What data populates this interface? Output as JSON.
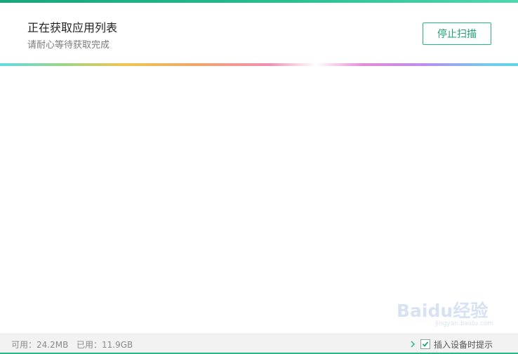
{
  "header": {
    "title": "正在获取应用列表",
    "subtitle": "请耐心等待获取完成",
    "stop_button_label": "停止扫描"
  },
  "footer": {
    "available_label": "可用：24.2MB",
    "used_label": "已用：11.9GB",
    "notify_checkbox_label": "插入设备时提示",
    "notify_checked": true
  },
  "watermark": {
    "brand_text": "Baidu经验",
    "url_text": "jingyan.baidu.com"
  },
  "colors": {
    "accent": "#25b388",
    "title_text": "#1f1f1f",
    "subtitle_text": "#7a7a7a"
  }
}
